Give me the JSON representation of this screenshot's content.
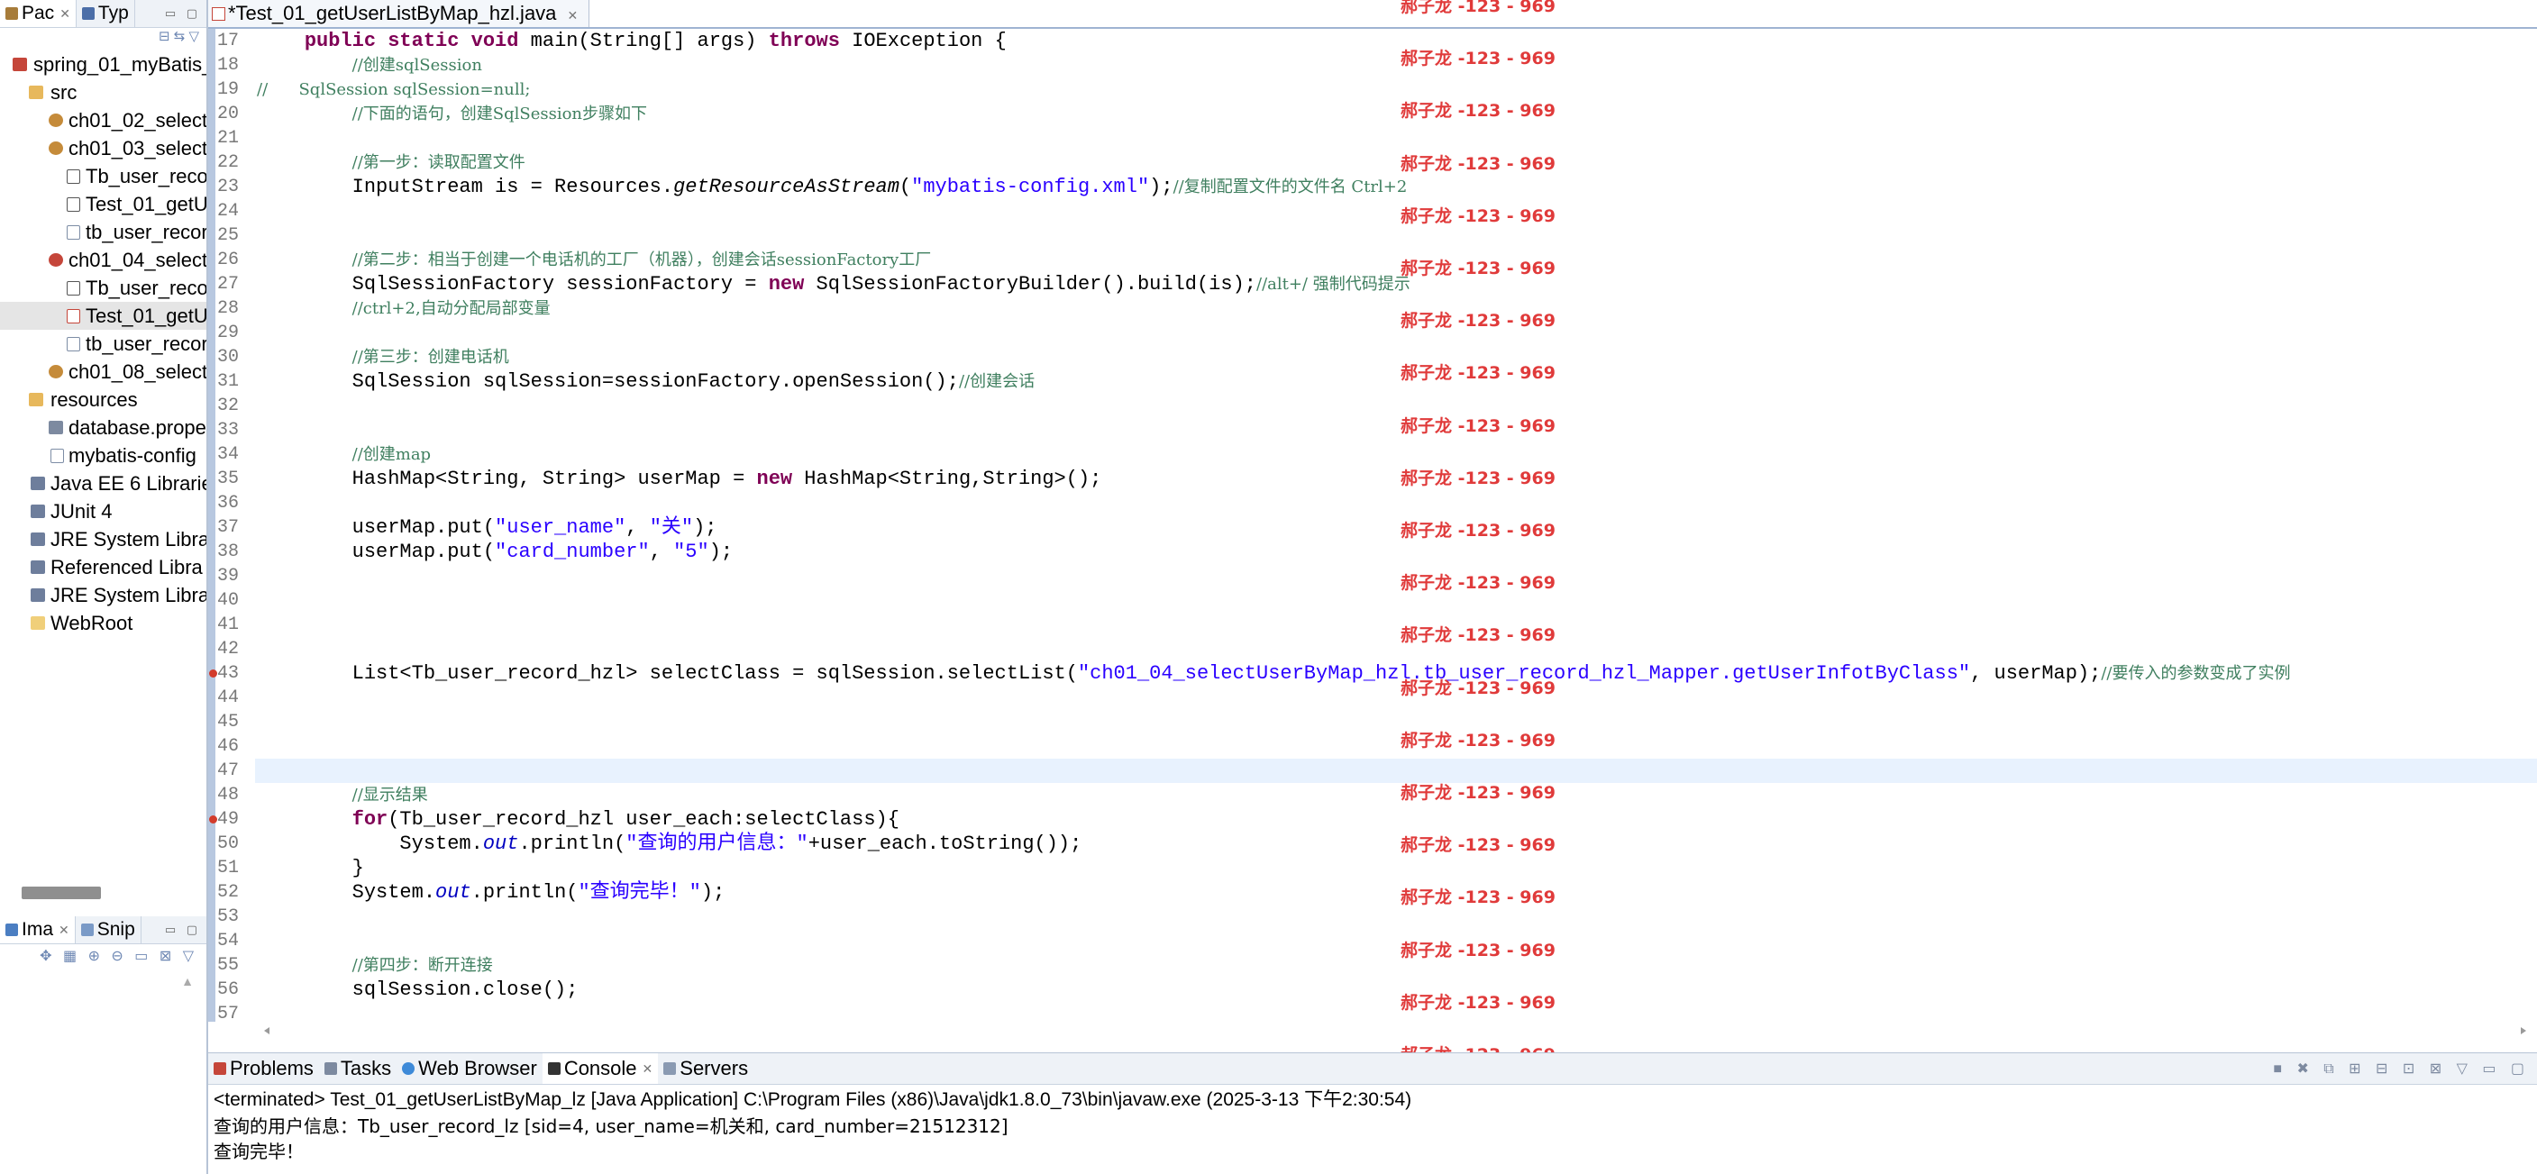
{
  "explorer": {
    "tabs": [
      {
        "label": "Pac"
      },
      {
        "label": "Typ"
      }
    ],
    "tree": [
      {
        "label": "spring_01_myBatis_"
      },
      {
        "label": "src"
      },
      {
        "label": "ch01_02_select"
      },
      {
        "label": "ch01_03_select"
      },
      {
        "label": "Tb_user_reco"
      },
      {
        "label": "Test_01_getU"
      },
      {
        "label": "tb_user_recor"
      },
      {
        "label": "ch01_04_select"
      },
      {
        "label": "Tb_user_reco"
      },
      {
        "label": "Test_01_getU"
      },
      {
        "label": "tb_user_recor"
      },
      {
        "label": "ch01_08_select"
      },
      {
        "label": "resources"
      },
      {
        "label": "database.prope"
      },
      {
        "label": "mybatis-config"
      },
      {
        "label": "Java EE 6 Librarie"
      },
      {
        "label": "JUnit 4"
      },
      {
        "label": "JRE System Libra"
      },
      {
        "label": "Referenced Libra"
      },
      {
        "label": "JRE System Libra"
      },
      {
        "label": "WebRoot"
      }
    ],
    "bottom_tabs": [
      {
        "label": "Ima"
      },
      {
        "label": "Snip"
      }
    ]
  },
  "editor": {
    "tab_title": "*Test_01_getUserListByMap_hzl.java",
    "lines": [
      {
        "n": "17",
        "t": "    public static void main(String[] args) throws IOException {"
      },
      {
        "n": "18",
        "t": "        //创建sqlSession"
      },
      {
        "n": "19",
        "t": "//      SqlSession sqlSession=null;"
      },
      {
        "n": "20",
        "t": "        //下面的语句，创建SqlSession步骤如下"
      },
      {
        "n": "21",
        "t": ""
      },
      {
        "n": "22",
        "t": "        //第一步：读取配置文件"
      },
      {
        "n": "23",
        "t": "        InputStream is = Resources.getResourceAsStream(\"mybatis-config.xml\");//复制配置文件的文件名 Ctrl+2"
      },
      {
        "n": "24",
        "t": ""
      },
      {
        "n": "25",
        "t": ""
      },
      {
        "n": "26",
        "t": "        //第二步：相当于创建一个电话机的工厂（机器），创建会话sessionFactory工厂"
      },
      {
        "n": "27",
        "t": "        SqlSessionFactory sessionFactory = new SqlSessionFactoryBuilder().build(is);//alt+/ 强制代码提示"
      },
      {
        "n": "28",
        "t": "        //ctrl+2,自动分配局部变量"
      },
      {
        "n": "29",
        "t": ""
      },
      {
        "n": "30",
        "t": "        //第三步：创建电话机"
      },
      {
        "n": "31",
        "t": "        SqlSession sqlSession=sessionFactory.openSession();//创建会话"
      },
      {
        "n": "32",
        "t": ""
      },
      {
        "n": "33",
        "t": ""
      },
      {
        "n": "34",
        "t": "        //创建map"
      },
      {
        "n": "35",
        "t": "        HashMap<String, String> userMap = new HashMap<String,String>();"
      },
      {
        "n": "36",
        "t": ""
      },
      {
        "n": "37",
        "t": "        userMap.put(\"user_name\", \"关\");"
      },
      {
        "n": "38",
        "t": "        userMap.put(\"card_number\", \"5\");"
      },
      {
        "n": "39",
        "t": ""
      },
      {
        "n": "40",
        "t": ""
      },
      {
        "n": "41",
        "t": ""
      },
      {
        "n": "42",
        "t": ""
      },
      {
        "n": "43",
        "t": "        List<Tb_user_record_hzl> selectClass = sqlSession.selectList(\"ch01_04_selectUserByMap_hzl.tb_user_record_hzl_Mapper.getUserInfotByClass\", userMap);//要传入的参数变成了实例"
      },
      {
        "n": "44",
        "t": ""
      },
      {
        "n": "45",
        "t": ""
      },
      {
        "n": "46",
        "t": ""
      },
      {
        "n": "47",
        "t": ""
      },
      {
        "n": "48",
        "t": "        //显示结果"
      },
      {
        "n": "49",
        "t": "        for(Tb_user_record_hzl user_each:selectClass){"
      },
      {
        "n": "50",
        "t": "            System.out.println(\"查询的用户信息：\"+user_each.toString());"
      },
      {
        "n": "51",
        "t": "        }"
      },
      {
        "n": "52",
        "t": "        System.out.println(\"查询完毕！\");"
      },
      {
        "n": "53",
        "t": ""
      },
      {
        "n": "54",
        "t": ""
      },
      {
        "n": "55",
        "t": "        //第四步：断开连接"
      },
      {
        "n": "56",
        "t": "        sqlSession.close();"
      },
      {
        "n": "57",
        "t": ""
      }
    ],
    "watermark": "郝子龙 -123 - 969"
  },
  "console": {
    "tabs": [
      {
        "label": "Problems"
      },
      {
        "label": "Tasks"
      },
      {
        "label": "Web Browser"
      },
      {
        "label": "Console"
      },
      {
        "label": "Servers"
      }
    ],
    "header": "<terminated> Test_01_getUserListByMap_lz [Java Application] C:\\Program Files (x86)\\Java\\jdk1.8.0_73\\bin\\javaw.exe (2025-3-13 下午2:30:54)",
    "output": [
      "查询的用户信息：Tb_user_record_lz [sid=4, user_name=机关和, card_number=21512312]",
      "查询完毕！"
    ]
  }
}
